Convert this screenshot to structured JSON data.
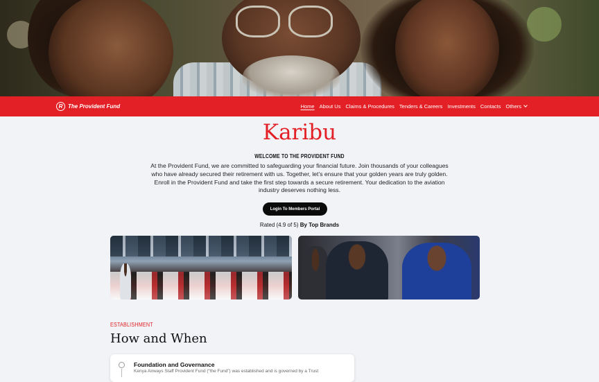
{
  "brand": {
    "logo_letter": "R",
    "name": "The Provident Fund",
    "accent_color": "#e32026"
  },
  "nav": {
    "items": [
      {
        "label": "Home",
        "active": true
      },
      {
        "label": "About Us"
      },
      {
        "label": "Claims & Procedures"
      },
      {
        "label": "Tenders & Careers"
      },
      {
        "label": "Investments"
      },
      {
        "label": "Contacts"
      },
      {
        "label": "Others",
        "has_dropdown": true
      }
    ]
  },
  "main": {
    "heading": "Karibu",
    "subtitle": "WELCOME TO THE PROVIDENT FUND",
    "intro": "At the Provident Fund, we are committed to safeguarding your financial future. Join thousands of your colleagues who have already secured their retirement with us. Together, let’s ensure that your golden years are truly golden. Enroll in the Provident Fund and take the first step towards a secure retirement. Your dedication to the aviation industry deserves nothing less.",
    "portal_button": "Login To Members Portal",
    "rated_prefix": "Rated",
    "rated_score": "(4.9 of 5)",
    "rated_suffix": "By Top Brands"
  },
  "section": {
    "eyebrow": "ESTABLISHMENT",
    "title": "How and When",
    "card_title": "Foundation and Governance",
    "card_text": "Kenya Airways Staff Provident Fund (“the Fund”) was established and is governed by a Trust"
  },
  "icons": {
    "dropdown": "chevron-down-icon",
    "timeline": "location-pin-icon"
  }
}
